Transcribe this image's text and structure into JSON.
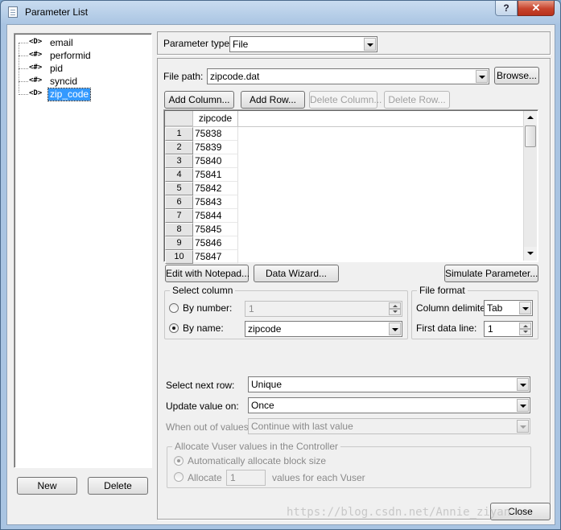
{
  "window": {
    "title": "Parameter List",
    "help_label": "?",
    "close_label": "✕"
  },
  "tree": {
    "items": [
      {
        "icon": "<D>",
        "label": "email",
        "selected": false
      },
      {
        "icon": "<#>",
        "label": "performid",
        "selected": false
      },
      {
        "icon": "<#>",
        "label": "pid",
        "selected": false
      },
      {
        "icon": "<#>",
        "label": "syncid",
        "selected": false
      },
      {
        "icon": "<D>",
        "label": "zip_code",
        "selected": true
      }
    ]
  },
  "left_buttons": {
    "new_label": "New",
    "delete_label": "Delete"
  },
  "parameter_type": {
    "label": "Parameter type:",
    "value": "File"
  },
  "file_path": {
    "label": "File path:",
    "value": "zipcode.dat",
    "browse_label": "Browse..."
  },
  "table_buttons": {
    "add_column": "Add Column...",
    "add_row": "Add Row...",
    "delete_column": "Delete Column...",
    "delete_row": "Delete Row..."
  },
  "table": {
    "column_header": "zipcode",
    "rows": [
      {
        "n": "1",
        "v": "75838"
      },
      {
        "n": "2",
        "v": "75839"
      },
      {
        "n": "3",
        "v": "75840"
      },
      {
        "n": "4",
        "v": "75841"
      },
      {
        "n": "5",
        "v": "75842"
      },
      {
        "n": "6",
        "v": "75843"
      },
      {
        "n": "7",
        "v": "75844"
      },
      {
        "n": "8",
        "v": "75845"
      },
      {
        "n": "9",
        "v": "75846"
      },
      {
        "n": "10",
        "v": "75847"
      }
    ]
  },
  "grid_buttons": {
    "edit_notepad": "Edit with Notepad...",
    "data_wizard": "Data Wizard...",
    "simulate": "Simulate Parameter..."
  },
  "select_column": {
    "title": "Select column",
    "by_number_label": "By number:",
    "by_number_value": "1",
    "by_name_label": "By name:",
    "by_name_value": "zipcode",
    "selected": "by_name"
  },
  "file_format": {
    "title": "File format",
    "delimiter_label": "Column delimiter:",
    "delimiter_value": "Tab",
    "first_line_label": "First data line:",
    "first_line_value": "1"
  },
  "select_next_row": {
    "label": "Select next row:",
    "value": "Unique"
  },
  "update_value_on": {
    "label": "Update value on:",
    "value": "Once"
  },
  "when_out_of_values": {
    "label": "When out of values:",
    "value": "Continue with last value"
  },
  "allocate": {
    "title": "Allocate Vuser values in the Controller",
    "auto_label": "Automatically allocate block size",
    "allocate_label": "Allocate",
    "allocate_value": "1",
    "suffix": "values for each Vuser"
  },
  "close_label": "Close",
  "watermark": "https://blog.csdn.net/Annie_ziyan"
}
